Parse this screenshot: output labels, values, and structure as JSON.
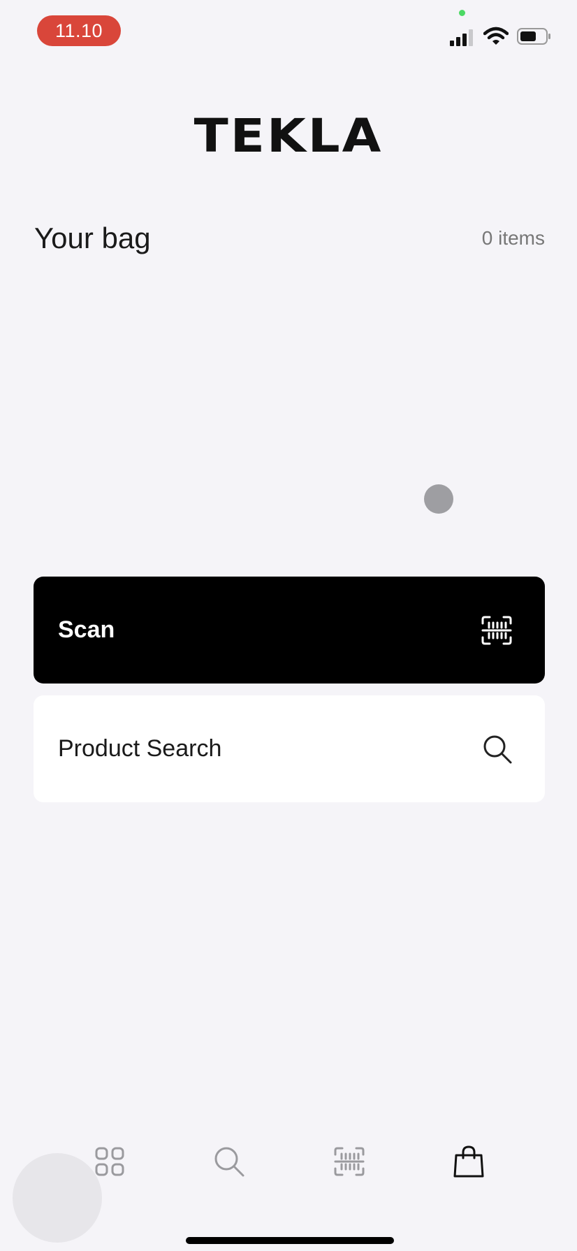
{
  "status_bar": {
    "time": "11.10",
    "signal_icon": "cellular-signal-icon",
    "wifi_icon": "wifi-icon",
    "battery_icon": "battery-icon"
  },
  "header": {
    "logo": "TEKLA"
  },
  "bag": {
    "title": "Your bag",
    "count": "0 items"
  },
  "actions": {
    "scan": {
      "label": "Scan",
      "icon": "barcode-scan-icon"
    },
    "search": {
      "label": "Product Search",
      "icon": "search-icon"
    }
  },
  "tab_bar": {
    "tabs": [
      {
        "name": "categories",
        "icon": "grid-icon",
        "active": false
      },
      {
        "name": "search",
        "icon": "search-icon",
        "active": false
      },
      {
        "name": "scan",
        "icon": "barcode-scan-icon",
        "active": false
      },
      {
        "name": "bag",
        "icon": "shopping-bag-icon",
        "active": true
      }
    ]
  },
  "colors": {
    "background": "#f5f4f8",
    "time_pill": "#d9463a",
    "scan_button": "#000000",
    "search_button": "#ffffff",
    "tab_inactive": "#9a9a9e",
    "tab_active": "#111111"
  }
}
